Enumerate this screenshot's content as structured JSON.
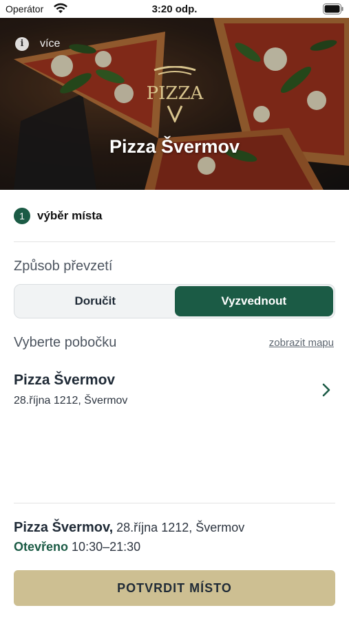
{
  "status_bar": {
    "carrier": "Operátor",
    "time": "3:20 odp."
  },
  "hero": {
    "info_label": "více",
    "logo_text": "PIZZA",
    "restaurant_name": "Pizza Švermov"
  },
  "step": {
    "number": "1",
    "label": "výběr místa"
  },
  "pickup": {
    "title": "Způsob převzetí",
    "options": [
      "Doručit",
      "Vyzvednout"
    ],
    "selected": "Vyzvednout"
  },
  "branch_select": {
    "title": "Vyberte pobočku",
    "map_link": "zobrazit mapu",
    "branches": [
      {
        "name": "Pizza Švermov",
        "address": "28.října 1212, Švermov"
      }
    ]
  },
  "summary": {
    "name": "Pizza Švermov,",
    "address": "28.října 1212, Švermov",
    "status": "Otevřeno",
    "hours": "10:30–21:30"
  },
  "confirm_button": "POTVRDIT MÍSTO",
  "colors": {
    "accent": "#1b5b45",
    "button": "#cdbf92"
  }
}
